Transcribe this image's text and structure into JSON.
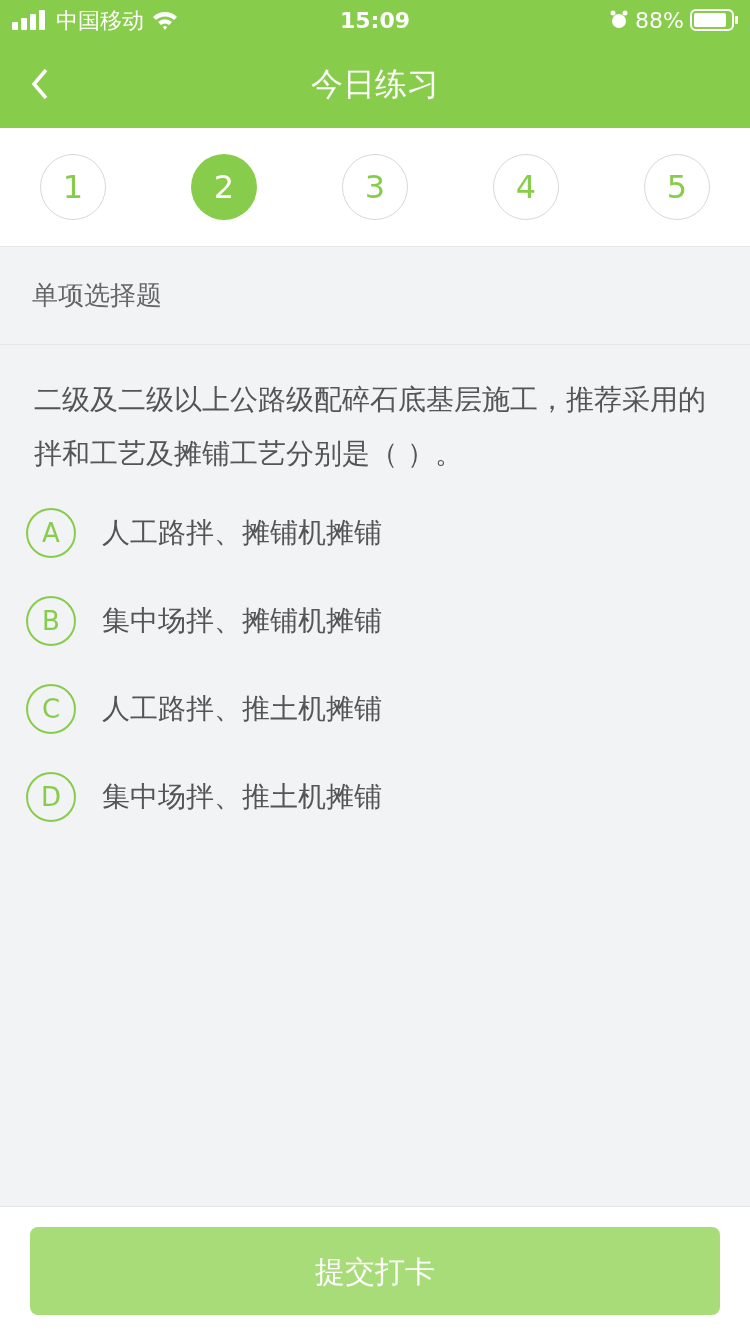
{
  "status_bar": {
    "carrier": "中国移动",
    "time": "15:09",
    "battery": "88%"
  },
  "header": {
    "title": "今日练习"
  },
  "steps": [
    {
      "label": "1",
      "selected": false
    },
    {
      "label": "2",
      "selected": true
    },
    {
      "label": "3",
      "selected": false
    },
    {
      "label": "4",
      "selected": false
    },
    {
      "label": "5",
      "selected": false
    }
  ],
  "section_label": "单项选择题",
  "question": "二级及二级以上公路级配碎石底基层施工，推荐采用的拌和工艺及摊铺工艺分别是（    ）。",
  "options": [
    {
      "letter": "A",
      "text": "人工路拌、摊铺机摊铺",
      "selected": false
    },
    {
      "letter": "B",
      "text": "集中场拌、摊铺机摊铺",
      "selected": false
    },
    {
      "letter": "C",
      "text": "人工路拌、推土机摊铺",
      "selected": false
    },
    {
      "letter": "D",
      "text": "集中场拌、推土机摊铺",
      "selected": false
    }
  ],
  "submit": {
    "label": "提交打卡",
    "disabled": true
  }
}
